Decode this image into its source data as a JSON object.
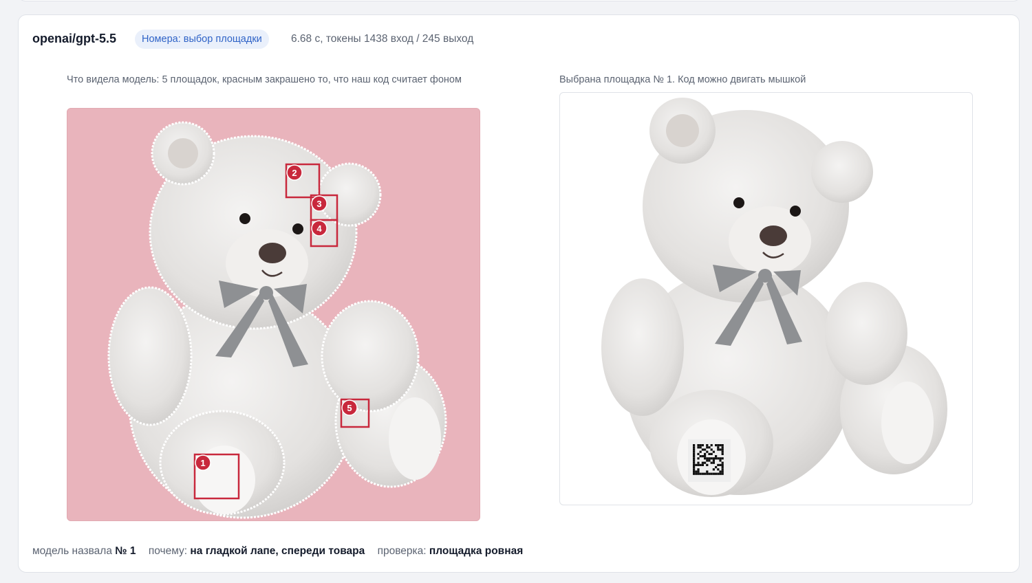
{
  "header": {
    "model": "openai/gpt-5.5",
    "badge": "Номера: выбор площадки",
    "meta": "6.68 с, токены 1438 вход / 245 выход"
  },
  "left_panel": {
    "caption": "Что видела модель: 5 площадок, красным закрашено то, что наш код считает фоном",
    "background_color": "#e9b4bc",
    "marker_color": "#c8283c",
    "markers": [
      "1",
      "2",
      "3",
      "4",
      "5"
    ]
  },
  "right_panel": {
    "caption": "Выбрана площадка № 1. Код можно двигать мышкой"
  },
  "footer": {
    "named_label": "модель назвала",
    "named_value": "№ 1",
    "why_label": "почему:",
    "why_value": "на гладкой лапе, спереди товара",
    "check_label": "проверка:",
    "check_value": "площадка ровная"
  }
}
